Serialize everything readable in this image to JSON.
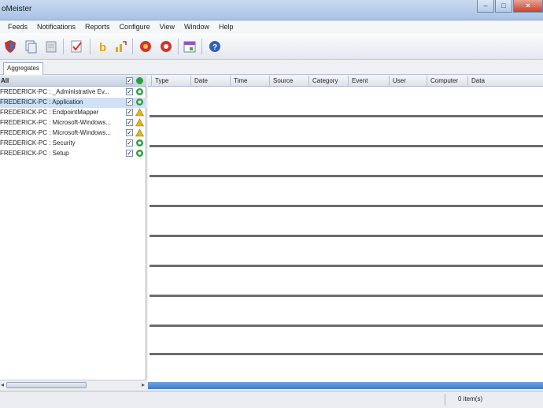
{
  "window": {
    "title": "oMeister"
  },
  "menu": [
    "Feeds",
    "Notifications",
    "Reports",
    "Configure",
    "View",
    "Window",
    "Help"
  ],
  "toolbar_icons": [
    "shield-icon",
    "copy-icon",
    "pages-icon",
    "check-list-icon",
    "b-icon",
    "chart-arrow-icon",
    "stop-red-icon",
    "stop-circle-icon",
    "calendar-icon",
    "help-icon"
  ],
  "tab": {
    "label": "Aggregates"
  },
  "left_panel": {
    "header": "All",
    "items": [
      {
        "label": "FREDERICK-PC : _Administrative Ev...",
        "checked": "✓",
        "status": "ok"
      },
      {
        "label": "FREDERICK-PC : Application",
        "checked": "✓",
        "status": "ok"
      },
      {
        "label": "FREDERICK-PC : EndpointMapper",
        "checked": "✓",
        "status": "warning"
      },
      {
        "label": "FREDERICK-PC : Microsoft-Windows...",
        "checked": "✓",
        "status": "warning"
      },
      {
        "label": "FREDERICK-PC : Microsoft-Windows...",
        "checked": "✓",
        "status": "warning"
      },
      {
        "label": "FREDERICK-PC : Security",
        "checked": "✓",
        "status": "ok"
      },
      {
        "label": "FREDERICK-PC : Setup",
        "checked": "✓",
        "status": "ok"
      }
    ]
  },
  "grid": {
    "columns": [
      "Type",
      "Date",
      "Time",
      "Source",
      "Category",
      "Event",
      "User",
      "Computer",
      "Data"
    ]
  },
  "status": {
    "count": "0 item(s)"
  },
  "colors": {
    "ok": "#2f9e3c",
    "warning": "#e7b416",
    "selection": "#cfe1f7",
    "accent": "#3f7cc4"
  }
}
